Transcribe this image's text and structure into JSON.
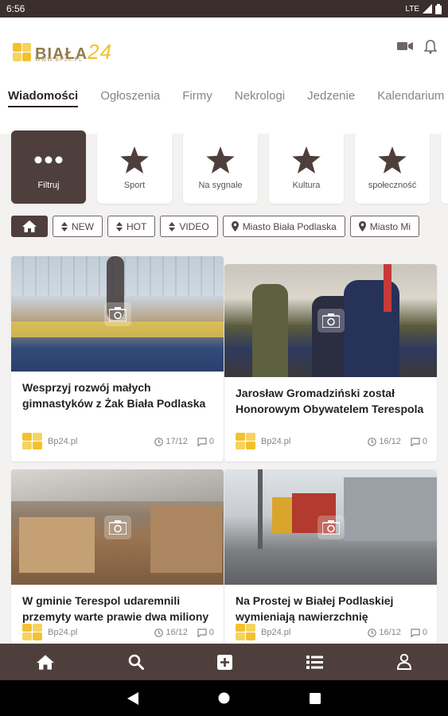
{
  "status_bar": {
    "time": "6:56",
    "network": "LTE"
  },
  "logo": {
    "name": "BIAŁA",
    "number": "24",
    "url": "WWW.BP24.PL"
  },
  "tabs": [
    "Wiadomości",
    "Ogłoszenia",
    "Firmy",
    "Nekrologi",
    "Jedzenie",
    "Kalendarium"
  ],
  "categories": [
    {
      "label": "Filtruj",
      "icon": "more-dots-icon"
    },
    {
      "label": "Sport",
      "icon": "star-icon"
    },
    {
      "label": "Na sygnale",
      "icon": "star-icon"
    },
    {
      "label": "Kultura",
      "icon": "star-icon"
    },
    {
      "label": "społeczność",
      "icon": "star-icon"
    }
  ],
  "chips": [
    "NEW",
    "HOT",
    "VIDEO",
    "Miasto Biała Podlaska",
    "Miasto Mi"
  ],
  "articles": [
    {
      "title": "Wesprzyj rozwój małych gimnastyków z Żak Biała Podlaska",
      "source": "Bp24.pl",
      "date": "17/12",
      "comments": "0"
    },
    {
      "title": "Jarosław Gromadziński został Honorowym Obywatelem Terespola",
      "source": "Bp24.pl",
      "date": "16/12",
      "comments": "0"
    },
    {
      "title": "W gminie Terespol udaremnili przemyty warte prawie dwa miliony",
      "source": "Bp24.pl",
      "date": "16/12",
      "comments": "0"
    },
    {
      "title": "Na Prostej w Białej Podlaskiej wymieniają nawierzchnię",
      "source": "Bp24.pl",
      "date": "16/12",
      "comments": "0"
    }
  ],
  "colors": {
    "primary": "#4e3f3c",
    "accent": "#f2c12e",
    "background": "#f3f2f1"
  }
}
